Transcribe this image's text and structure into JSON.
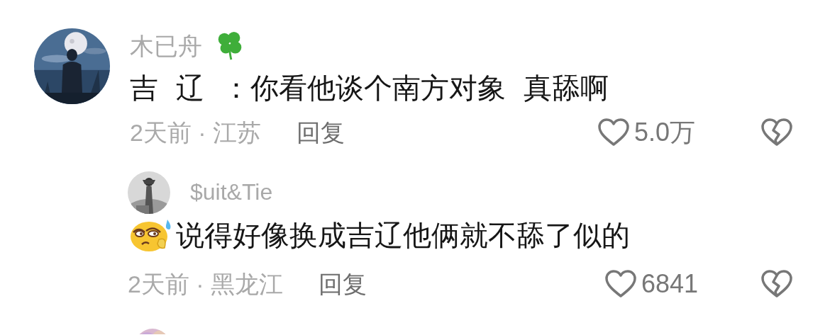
{
  "comments": [
    {
      "avatar": {
        "kind": "picture"
      },
      "user": "木已舟",
      "clover_badge": true,
      "text": "吉 辽 ：你看他谈个南方对象 真舔啊",
      "meta": "2天前 · 江苏",
      "reply_label": "回复",
      "likes": "5.0万",
      "replies": [
        {
          "avatar": {
            "kind": "picture"
          },
          "user": "$uit&Tie",
          "sweat_emoji": true,
          "text": "说得好像换成吉辽他俩就不舔了似的",
          "meta": "2天前 · 黑龙江",
          "reply_label": "回复",
          "likes": "6841"
        }
      ]
    },
    {
      "avatar": {
        "kind": "picture"
      }
    }
  ]
}
